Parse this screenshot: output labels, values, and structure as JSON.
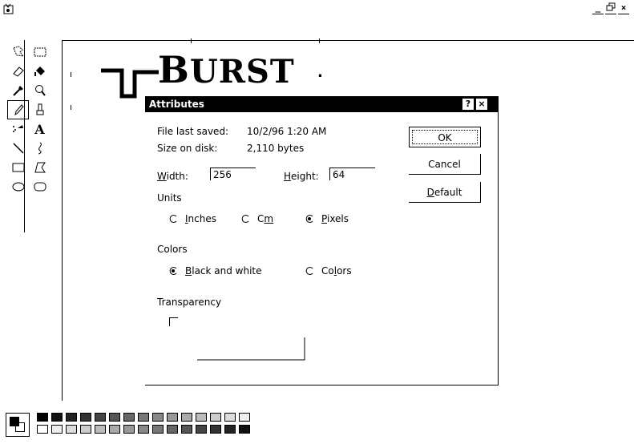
{
  "window": {
    "controls": [
      "_",
      "̸",
      "×"
    ]
  },
  "toolbox": {
    "tools": [
      {
        "name": "free-form-select-icon",
        "selected": false
      },
      {
        "name": "rect-select-icon",
        "selected": false
      },
      {
        "name": "eraser-icon",
        "selected": false
      },
      {
        "name": "fill-bucket-icon",
        "selected": false
      },
      {
        "name": "eyedropper-icon",
        "selected": false
      },
      {
        "name": "magnifier-icon",
        "selected": false
      },
      {
        "name": "pencil-icon",
        "selected": true
      },
      {
        "name": "brush-icon",
        "selected": false
      },
      {
        "name": "airbrush-icon",
        "selected": false
      },
      {
        "name": "text-icon",
        "selected": false
      },
      {
        "name": "line-icon",
        "selected": false
      },
      {
        "name": "curve-icon",
        "selected": false
      },
      {
        "name": "rectangle-icon",
        "selected": false
      },
      {
        "name": "polygon-icon",
        "selected": false
      },
      {
        "name": "ellipse-icon",
        "selected": false
      },
      {
        "name": "rounded-rect-icon",
        "selected": false
      }
    ],
    "text_tool_glyph": "A"
  },
  "canvas": {
    "logo_first": "B",
    "logo_rest": "URST",
    "dot": "."
  },
  "dialog": {
    "title": "Attributes",
    "help": "?",
    "close": "×",
    "file_last_saved_label": "File last saved:",
    "file_last_saved_value": "10/2/96 1:20 AM",
    "size_on_disk_label": "Size on disk:",
    "size_on_disk_value": "2,110 bytes",
    "width_label_u": "W",
    "width_label_rest": "idth:",
    "width_value": "256",
    "height_label_u": "H",
    "height_label_rest": "eight:",
    "height_value": "64",
    "units_label": "Units",
    "units": {
      "inches_u": "I",
      "inches_rest": "nches",
      "cm_pre": "C",
      "cm_u": "m",
      "pixels_u": "P",
      "pixels_rest": "ixels",
      "selected": "pixels"
    },
    "colors_label": "Colors",
    "colors": {
      "bw_u": "B",
      "bw_rest": "lack and white",
      "colors_pre": "Co",
      "colors_u": "l",
      "colors_rest": "ors",
      "selected": "black-and-white"
    },
    "transparency_label": "Transparency",
    "transparency_checked": false,
    "ok_label": "OK",
    "cancel_label": "Cancel",
    "default_u": "D",
    "default_rest": "efault"
  },
  "palette": {
    "row1": [
      "#000",
      "#111",
      "#222",
      "#333",
      "#444",
      "#555",
      "#666",
      "#777",
      "#888",
      "#999",
      "#aaa",
      "#bbb",
      "#ccc",
      "#ddd",
      "#eee"
    ],
    "row2": [
      "#fff",
      "#eee",
      "#ddd",
      "#ccc",
      "#bbb",
      "#aaa",
      "#999",
      "#888",
      "#777",
      "#666",
      "#555",
      "#444",
      "#333",
      "#222",
      "#111"
    ]
  }
}
